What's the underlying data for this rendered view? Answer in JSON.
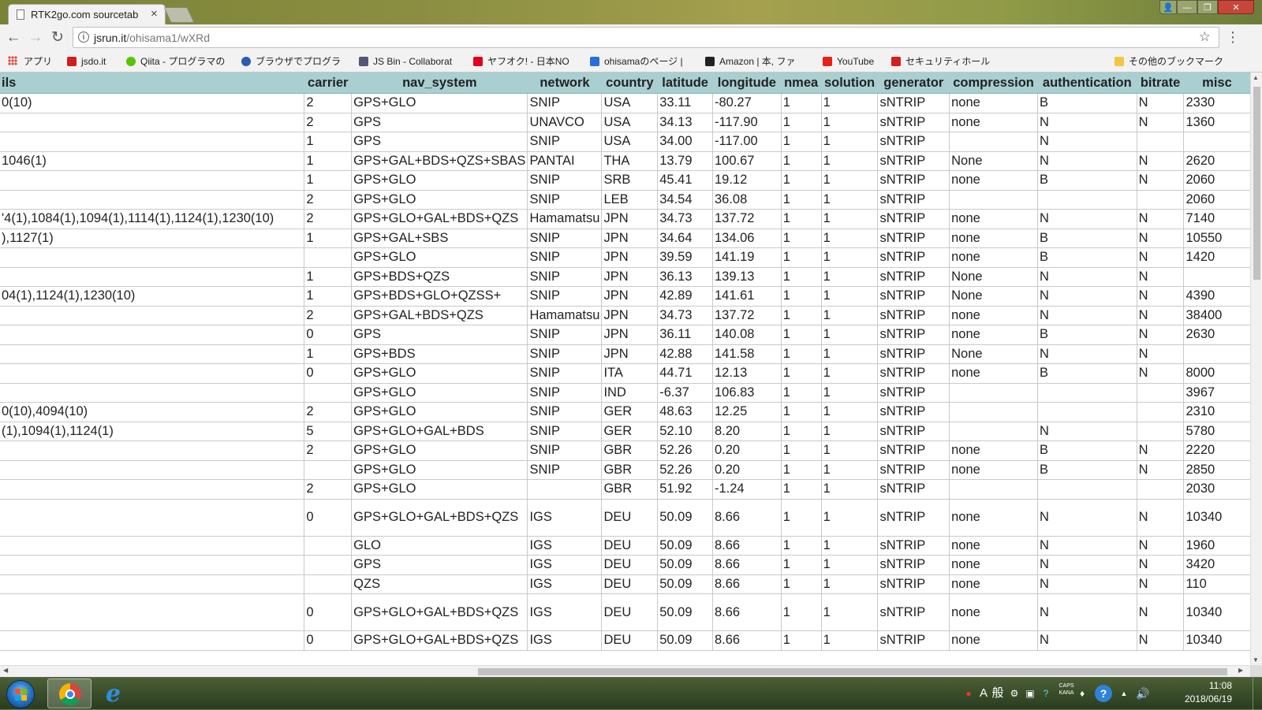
{
  "browser": {
    "tab_title": "RTK2go.com sourcetab",
    "tab_close": "×",
    "url_host": "jsrun.it",
    "url_path": "/ohisama1/wXRd",
    "window_controls": {
      "user": "👤",
      "minimize": "—",
      "maximize": "❐",
      "close": "✕"
    }
  },
  "bookmarks": [
    {
      "label": "アプリ",
      "icon": "apps-grid-icon",
      "color": "#e24a3b"
    },
    {
      "label": "jsdo.it",
      "icon": "jsdo-icon",
      "color": "#cc2020"
    },
    {
      "label": "Qiita - プログラマの",
      "icon": "qiita-icon",
      "color": "#55c500"
    },
    {
      "label": "ブラウザでプログラ",
      "icon": "circle-icon",
      "color": "#2a5db0"
    },
    {
      "label": "JS Bin - Collaborat",
      "icon": "jsbin-icon",
      "color": "#555577"
    },
    {
      "label": "ヤフオク! - 日本NO",
      "icon": "yahoo-icon",
      "color": "#e0001b"
    },
    {
      "label": "ohisamaのページ |",
      "icon": "hatena-icon",
      "color": "#2a6ed9"
    },
    {
      "label": "Amazon | 本, ファ",
      "icon": "amazon-icon",
      "color": "#222222"
    },
    {
      "label": "YouTube",
      "icon": "youtube-icon",
      "color": "#e62117"
    },
    {
      "label": "セキュリティホール",
      "icon": "check-icon",
      "color": "#d21f1f"
    },
    {
      "label": "その他のブックマーク",
      "icon": "folder-icon",
      "color": "#f4c542"
    }
  ],
  "table": {
    "headers": [
      "ils",
      "carrier",
      "nav_system",
      "network",
      "country",
      "latitude",
      "longitude",
      "nmea",
      "solution",
      "generator",
      "compression",
      "authentication",
      "bitrate",
      "misc"
    ],
    "rows": [
      [
        "0(10)",
        "2",
        "GPS+GLO",
        "SNIP",
        "USA",
        "33.11",
        "-80.27",
        "1",
        "1",
        "sNTRIP",
        "none",
        "B",
        "N",
        "2330"
      ],
      [
        "",
        "2",
        "GPS",
        "UNAVCO",
        "USA",
        "34.13",
        "-117.90",
        "1",
        "1",
        "sNTRIP",
        "none",
        "N",
        "N",
        "1360"
      ],
      [
        "",
        "1",
        "GPS",
        "SNIP",
        "USA",
        "34.00",
        "-117.00",
        "1",
        "1",
        "sNTRIP",
        "",
        "N",
        "",
        ""
      ],
      [
        "1046(1)",
        "1",
        "GPS+GAL+BDS+QZS+SBAS",
        "PANTAI",
        "THA",
        "13.79",
        "100.67",
        "1",
        "1",
        "sNTRIP",
        "None",
        "N",
        "N",
        "2620"
      ],
      [
        "",
        "1",
        "GPS+GLO",
        "SNIP",
        "SRB",
        "45.41",
        "19.12",
        "1",
        "1",
        "sNTRIP",
        "none",
        "B",
        "N",
        "2060"
      ],
      [
        "",
        "2",
        "GPS+GLO",
        "SNIP",
        "LEB",
        "34.54",
        "36.08",
        "1",
        "1",
        "sNTRIP",
        "",
        "",
        "",
        "2060"
      ],
      [
        "'4(1),1084(1),1094(1),1114(1),1124(1),1230(10)",
        "2",
        "GPS+GLO+GAL+BDS+QZS",
        "Hamamatsu",
        "JPN",
        "34.73",
        "137.72",
        "1",
        "1",
        "sNTRIP",
        "none",
        "N",
        "N",
        "7140"
      ],
      [
        "),1127(1)",
        "1",
        "GPS+GAL+SBS",
        "SNIP",
        "JPN",
        "34.64",
        "134.06",
        "1",
        "1",
        "sNTRIP",
        "none",
        "B",
        "N",
        "10550"
      ],
      [
        "",
        "",
        "GPS+GLO",
        "SNIP",
        "JPN",
        "39.59",
        "141.19",
        "1",
        "1",
        "sNTRIP",
        "none",
        "B",
        "N",
        "1420"
      ],
      [
        "",
        "1",
        "GPS+BDS+QZS",
        "SNIP",
        "JPN",
        "36.13",
        "139.13",
        "1",
        "1",
        "sNTRIP",
        "None",
        "N",
        "N",
        ""
      ],
      [
        "04(1),1124(1),1230(10)",
        "1",
        "GPS+BDS+GLO+QZSS+",
        "SNIP",
        "JPN",
        "42.89",
        "141.61",
        "1",
        "1",
        "sNTRIP",
        "None",
        "N",
        "N",
        "4390"
      ],
      [
        "",
        "2",
        "GPS+GAL+BDS+QZS",
        "Hamamatsu",
        "JPN",
        "34.73",
        "137.72",
        "1",
        "1",
        "sNTRIP",
        "none",
        "N",
        "N",
        "38400"
      ],
      [
        "",
        "0",
        "GPS",
        "SNIP",
        "JPN",
        "36.11",
        "140.08",
        "1",
        "1",
        "sNTRIP",
        "none",
        "B",
        "N",
        "2630"
      ],
      [
        "",
        "1",
        "GPS+BDS",
        "SNIP",
        "JPN",
        "42.88",
        "141.58",
        "1",
        "1",
        "sNTRIP",
        "None",
        "N",
        "N",
        ""
      ],
      [
        "",
        "0",
        "GPS+GLO",
        "SNIP",
        "ITA",
        "44.71",
        "12.13",
        "1",
        "1",
        "sNTRIP",
        "none",
        "B",
        "N",
        "8000"
      ],
      [
        "",
        "",
        "GPS+GLO",
        "SNIP",
        "IND",
        "-6.37",
        "106.83",
        "1",
        "1",
        "sNTRIP",
        "",
        "",
        "",
        "3967"
      ],
      [
        "0(10),4094(10)",
        "2",
        "GPS+GLO",
        "SNIP",
        "GER",
        "48.63",
        "12.25",
        "1",
        "1",
        "sNTRIP",
        "",
        "",
        "",
        "2310"
      ],
      [
        "(1),1094(1),1124(1)",
        "5",
        "GPS+GLO+GAL+BDS",
        "SNIP",
        "GER",
        "52.10",
        "8.20",
        "1",
        "1",
        "sNTRIP",
        "",
        "N",
        "",
        "5780"
      ],
      [
        "",
        "2",
        "GPS+GLO",
        "SNIP",
        "GBR",
        "52.26",
        "0.20",
        "1",
        "1",
        "sNTRIP",
        "none",
        "B",
        "N",
        "2220"
      ],
      [
        "",
        "",
        "GPS+GLO",
        "SNIP",
        "GBR",
        "52.26",
        "0.20",
        "1",
        "1",
        "sNTRIP",
        "none",
        "B",
        "N",
        "2850"
      ],
      [
        "",
        "2",
        "GPS+GLO",
        "",
        "GBR",
        "51.92",
        "-1.24",
        "1",
        "1",
        "sNTRIP",
        "",
        "",
        "",
        "2030"
      ],
      [
        "",
        "0",
        "GPS+GLO+GAL+BDS+QZS",
        "IGS",
        "DEU",
        "50.09",
        "8.66",
        "1",
        "1",
        "sNTRIP",
        "none",
        "N",
        "N",
        "10340"
      ],
      [
        "",
        "",
        "GLO",
        "IGS",
        "DEU",
        "50.09",
        "8.66",
        "1",
        "1",
        "sNTRIP",
        "none",
        "N",
        "N",
        "1960"
      ],
      [
        "",
        "",
        "GPS",
        "IGS",
        "DEU",
        "50.09",
        "8.66",
        "1",
        "1",
        "sNTRIP",
        "none",
        "N",
        "N",
        "3420"
      ],
      [
        "",
        "",
        "QZS",
        "IGS",
        "DEU",
        "50.09",
        "8.66",
        "1",
        "1",
        "sNTRIP",
        "none",
        "N",
        "N",
        "110"
      ],
      [
        "",
        "0",
        "GPS+GLO+GAL+BDS+QZS",
        "IGS",
        "DEU",
        "50.09",
        "8.66",
        "1",
        "1",
        "sNTRIP",
        "none",
        "N",
        "N",
        "10340"
      ],
      [
        "",
        "0",
        "GPS+GLO+GAL+BDS+QZS",
        "IGS",
        "DEU",
        "50.09",
        "8.66",
        "1",
        "1",
        "sNTRIP",
        "none",
        "N",
        "N",
        "10340"
      ]
    ],
    "tall_rows": [
      21,
      25
    ]
  },
  "taskbar": {
    "tray": [
      "A",
      "般",
      "CAPS",
      "KANA",
      "?"
    ],
    "time": "11:08",
    "date": "2018/06/19"
  }
}
